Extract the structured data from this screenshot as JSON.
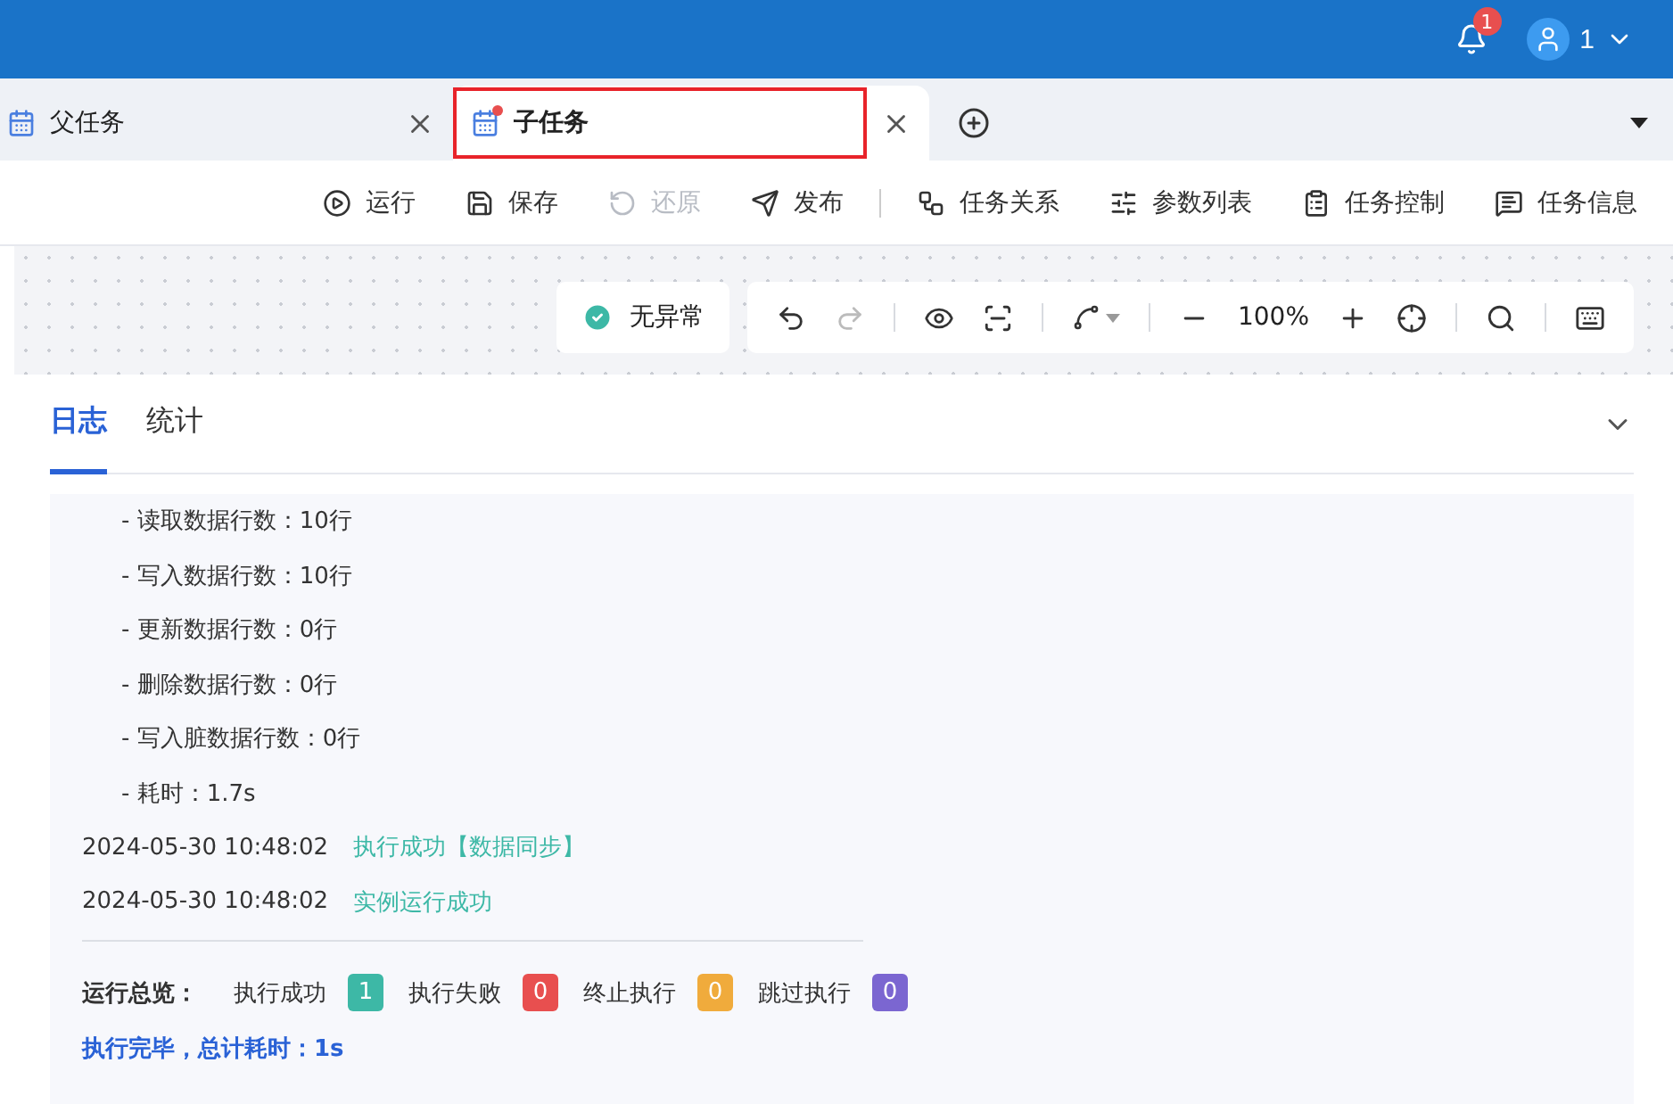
{
  "header": {
    "notification_count": "1",
    "user": "1"
  },
  "tabs": [
    {
      "label": "父任务",
      "selected": false,
      "modified": false,
      "highlighted": false
    },
    {
      "label": "子任务",
      "selected": true,
      "modified": true,
      "highlighted": true
    }
  ],
  "toolbar": [
    {
      "kind": "button",
      "label": "运行",
      "disabled": false
    },
    {
      "kind": "button",
      "label": "保存",
      "disabled": false
    },
    {
      "kind": "button",
      "label": "还原",
      "disabled": true
    },
    {
      "kind": "button",
      "label": "发布",
      "disabled": false
    },
    {
      "kind": "separator"
    },
    {
      "kind": "button",
      "label": "任务关系",
      "disabled": false
    },
    {
      "kind": "button",
      "label": "参数列表",
      "disabled": false
    },
    {
      "kind": "button",
      "label": "任务控制",
      "disabled": false
    },
    {
      "kind": "button",
      "label": "任务信息",
      "disabled": false
    }
  ],
  "canvas": {
    "status": "无异常",
    "zoom": "100%"
  },
  "panel_tabs": [
    {
      "label": "日志",
      "selected": true
    },
    {
      "label": "统计",
      "selected": false
    }
  ],
  "log": [
    {
      "kind": "stat",
      "text": "- 读取数据行数：10行"
    },
    {
      "kind": "stat",
      "text": "- 写入数据行数：10行"
    },
    {
      "kind": "stat",
      "text": "- 更新数据行数：0行"
    },
    {
      "kind": "stat",
      "text": "- 删除数据行数：0行"
    },
    {
      "kind": "stat",
      "text": "- 写入脏数据行数：0行"
    },
    {
      "kind": "stat",
      "text": "- 耗时：1.7s"
    },
    {
      "kind": "event",
      "time": "2024-05-30 10:48:02",
      "message": "执行成功【数据同步】"
    },
    {
      "kind": "event",
      "time": "2024-05-30 10:48:02",
      "message": "实例运行成功"
    }
  ],
  "summary": {
    "label": "运行总览：",
    "counts": [
      {
        "label": "执行成功",
        "count": "1",
        "color": "#3db8a6"
      },
      {
        "label": "执行失败",
        "count": "0",
        "color": "#e84f4f"
      },
      {
        "label": "终止执行",
        "count": "0",
        "color": "#f0ab3c"
      },
      {
        "label": "跳过执行",
        "count": "0",
        "color": "#7b66d1"
      }
    ],
    "footer": "执行完毕，总计耗时：1s"
  }
}
